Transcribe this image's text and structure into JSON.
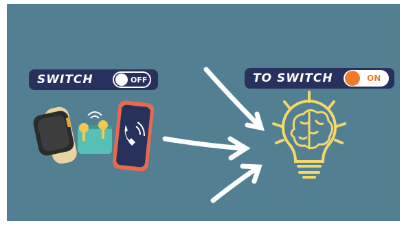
{
  "left_label": {
    "text": "SWITCH",
    "toggle_state": "OFF"
  },
  "right_label": {
    "text": "TO SWITCH",
    "toggle_state": "ON"
  },
  "colors": {
    "background": "#537f92",
    "pill": "#27315c",
    "toggle_on": "#ef7b2c",
    "bulb": "#f3d86a",
    "watch_band": "#e9d3a2",
    "phone_case": "#e86a4b",
    "earbuds_case": "#57c0b5"
  },
  "icons": [
    "smartwatch-icon",
    "earbuds-icon",
    "phone-icon",
    "arrow-icon",
    "lightbulb-icon",
    "brain-icon"
  ]
}
